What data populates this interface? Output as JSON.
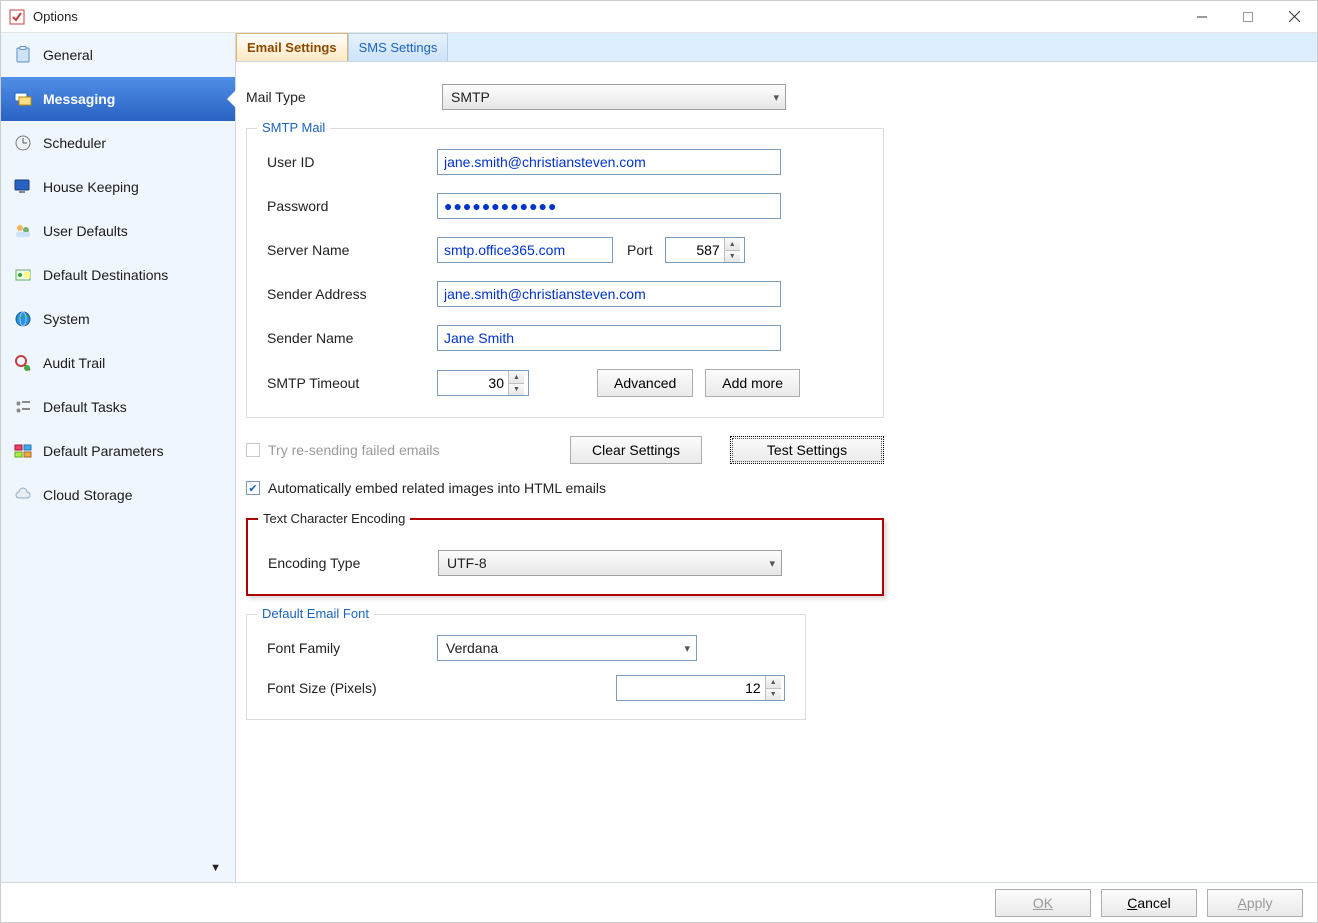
{
  "window": {
    "title": "Options"
  },
  "sidebar": {
    "items": [
      {
        "label": "General"
      },
      {
        "label": "Messaging"
      },
      {
        "label": "Scheduler"
      },
      {
        "label": "House Keeping"
      },
      {
        "label": "User Defaults"
      },
      {
        "label": "Default Destinations"
      },
      {
        "label": "System"
      },
      {
        "label": "Audit Trail"
      },
      {
        "label": "Default Tasks"
      },
      {
        "label": "Default Parameters"
      },
      {
        "label": "Cloud Storage"
      }
    ],
    "selected_index": 1
  },
  "tabs": {
    "items": [
      {
        "label": "Email Settings"
      },
      {
        "label": "SMS Settings"
      }
    ],
    "active_index": 0
  },
  "mail": {
    "type_label": "Mail Type",
    "type_value": "SMTP"
  },
  "smtp": {
    "legend": "SMTP Mail",
    "user_id_label": "User ID",
    "user_id": "jane.smith@christiansteven.com",
    "password_label": "Password",
    "password": "●●●●●●●●●●●●",
    "server_label": "Server Name",
    "server": "smtp.office365.com",
    "port_label": "Port",
    "port": "587",
    "sender_addr_label": "Sender Address",
    "sender_addr": "jane.smith@christiansteven.com",
    "sender_name_label": "Sender Name",
    "sender_name": "Jane Smith",
    "timeout_label": "SMTP Timeout",
    "timeout": "30",
    "advanced_btn": "Advanced",
    "addmore_btn": "Add more"
  },
  "options": {
    "retry_label": "Try re-sending failed emails",
    "retry_checked": false,
    "retry_disabled": true,
    "clear_btn": "Clear Settings",
    "test_btn": "Test Settings",
    "embed_label": "Automatically embed related images into HTML emails",
    "embed_checked": true
  },
  "encoding": {
    "legend": "Text Character Encoding",
    "type_label": "Encoding Type",
    "type_value": "UTF-8"
  },
  "font": {
    "legend": "Default Email Font",
    "family_label": "Font Family",
    "family_value": "Verdana",
    "size_label": "Font Size (Pixels)",
    "size_value": "12"
  },
  "footer": {
    "ok": "OK",
    "cancel": "Cancel",
    "apply": "Apply"
  }
}
